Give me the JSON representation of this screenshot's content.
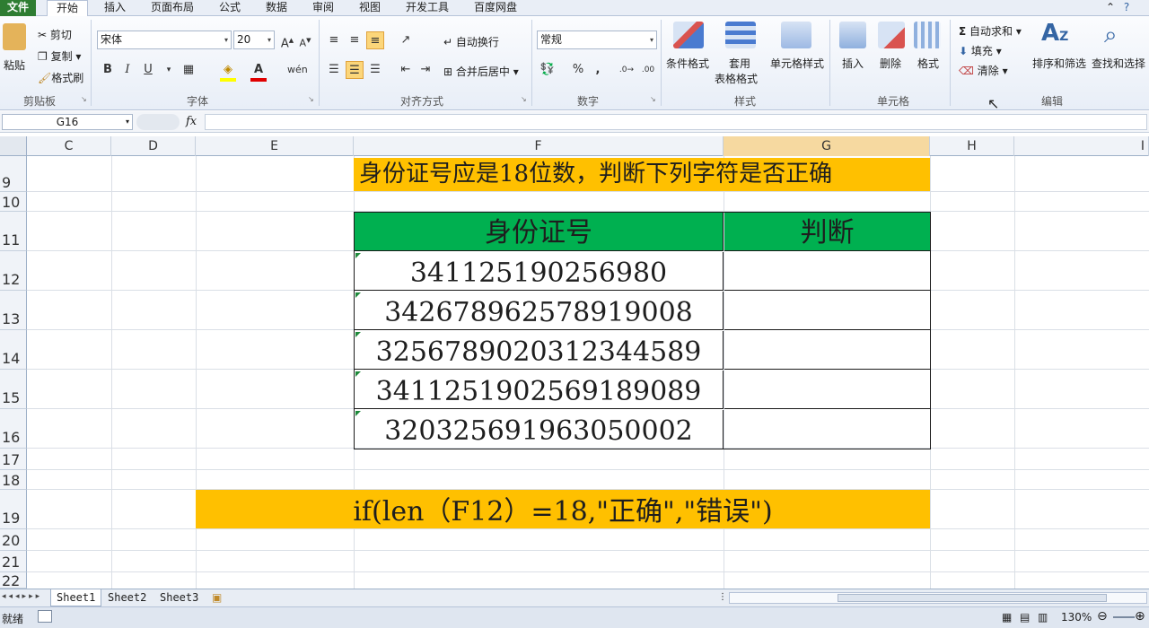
{
  "tabs": [
    "文件",
    "开始",
    "插入",
    "页面布局",
    "公式",
    "数据",
    "审阅",
    "视图",
    "开发工具",
    "百度网盘"
  ],
  "clipboard": {
    "paste": "粘贴",
    "cut": "剪切",
    "copy": "复制",
    "format_painter": "格式刷",
    "label": "剪贴板"
  },
  "font": {
    "name": "宋体",
    "size": "20",
    "bold": "B",
    "italic": "I",
    "underline": "U",
    "label": "字体"
  },
  "align": {
    "wrap": "自动换行",
    "merge": "合并后居中",
    "label": "对齐方式"
  },
  "number": {
    "format": "常规",
    "percent": "%",
    "comma": ",",
    "label": "数字"
  },
  "styles": {
    "cond": "条件格式",
    "table1": "套用",
    "table2": "表格格式",
    "cell": "单元格样式",
    "label": "样式"
  },
  "cells": {
    "insert": "插入",
    "delete": "删除",
    "format": "格式",
    "label": "单元格"
  },
  "editing": {
    "autosum": "自动求和",
    "fill": "填充",
    "clear": "清除",
    "sort": "排序和筛选",
    "find": "查找和选择",
    "label": "编辑"
  },
  "formula_bar": {
    "name_box": "G16",
    "fx": "fx",
    "content": ""
  },
  "columns": [
    "C",
    "D",
    "E",
    "F",
    "G",
    "H",
    "I"
  ],
  "rows": [
    "9",
    "10",
    "11",
    "12",
    "13",
    "14",
    "15",
    "16",
    "17",
    "18",
    "19",
    "20",
    "21",
    "22"
  ],
  "sheet": {
    "title": "身份证号应是18位数，判断下列字符是否正确",
    "header_id": "身份证号",
    "header_judge": "判断",
    "ids": [
      "341125190256980",
      "342678962578919008",
      "325678902031234458​9",
      "3411251902569189089",
      "320325691963050002"
    ],
    "formula": "if(len（F12）=18,\"正确\",\"错误\")"
  },
  "sheet_tabs": [
    "Sheet1",
    "Sheet2",
    "Sheet3"
  ],
  "status": {
    "ready": "就绪",
    "zoom": "130%"
  },
  "colors": {
    "header_green": "#00b050",
    "highlight_yellow": "#ffc000",
    "file_tab": "#2e7d32"
  }
}
